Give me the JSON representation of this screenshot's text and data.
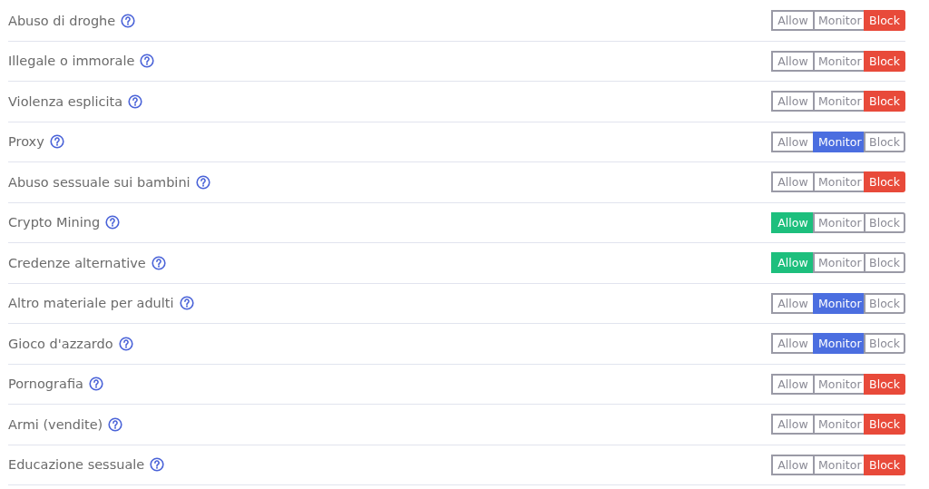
{
  "rows": [
    {
      "label": "Abuso di droghe",
      "options": [
        {
          "label": "Allow",
          "kind": "allow",
          "selected": false
        },
        {
          "label": "Monitor",
          "kind": "monitor",
          "selected": false
        },
        {
          "label": "Block",
          "kind": "block",
          "selected": true
        }
      ]
    },
    {
      "label": "Illegale o immorale",
      "options": [
        {
          "label": "Allow",
          "kind": "allow",
          "selected": false
        },
        {
          "label": "Monitor",
          "kind": "monitor",
          "selected": false
        },
        {
          "label": "Block",
          "kind": "block",
          "selected": true
        }
      ]
    },
    {
      "label": "Violenza esplicita",
      "options": [
        {
          "label": "Allow",
          "kind": "allow",
          "selected": false
        },
        {
          "label": "Monitor",
          "kind": "monitor",
          "selected": false
        },
        {
          "label": "Block",
          "kind": "block",
          "selected": true
        }
      ]
    },
    {
      "label": "Proxy",
      "options": [
        {
          "label": "Allow",
          "kind": "allow",
          "selected": false
        },
        {
          "label": "Monitor",
          "kind": "monitor",
          "selected": true
        },
        {
          "label": "Block",
          "kind": "block",
          "selected": false
        }
      ]
    },
    {
      "label": "Abuso sessuale sui bambini",
      "options": [
        {
          "label": "Allow",
          "kind": "allow",
          "selected": false
        },
        {
          "label": "Monitor",
          "kind": "monitor",
          "selected": false
        },
        {
          "label": "Block",
          "kind": "block",
          "selected": true
        }
      ]
    },
    {
      "label": "Crypto Mining",
      "options": [
        {
          "label": "Allow",
          "kind": "allow",
          "selected": true
        },
        {
          "label": "Monitor",
          "kind": "monitor",
          "selected": false
        },
        {
          "label": "Block",
          "kind": "block",
          "selected": false
        }
      ]
    },
    {
      "label": "Credenze alternative",
      "options": [
        {
          "label": "Allow",
          "kind": "allow",
          "selected": true
        },
        {
          "label": "Monitor",
          "kind": "monitor",
          "selected": false
        },
        {
          "label": "Block",
          "kind": "block",
          "selected": false
        }
      ]
    },
    {
      "label": "Altro materiale per adulti",
      "options": [
        {
          "label": "Allow",
          "kind": "allow",
          "selected": false
        },
        {
          "label": "Monitor",
          "kind": "monitor",
          "selected": true
        },
        {
          "label": "Block",
          "kind": "block",
          "selected": false
        }
      ]
    },
    {
      "label": "Gioco d'azzardo",
      "options": [
        {
          "label": "Allow",
          "kind": "allow",
          "selected": false
        },
        {
          "label": "Monitor",
          "kind": "monitor",
          "selected": true
        },
        {
          "label": "Block",
          "kind": "block",
          "selected": false
        }
      ]
    },
    {
      "label": "Pornografia",
      "options": [
        {
          "label": "Allow",
          "kind": "allow",
          "selected": false
        },
        {
          "label": "Monitor",
          "kind": "monitor",
          "selected": false
        },
        {
          "label": "Block",
          "kind": "block",
          "selected": true
        }
      ]
    },
    {
      "label": "Armi (vendite)",
      "options": [
        {
          "label": "Allow",
          "kind": "allow",
          "selected": false
        },
        {
          "label": "Monitor",
          "kind": "monitor",
          "selected": false
        },
        {
          "label": "Block",
          "kind": "block",
          "selected": true
        }
      ]
    },
    {
      "label": "Educazione sessuale",
      "options": [
        {
          "label": "Allow",
          "kind": "allow",
          "selected": false
        },
        {
          "label": "Monitor",
          "kind": "monitor",
          "selected": false
        },
        {
          "label": "Block",
          "kind": "block",
          "selected": true
        }
      ]
    }
  ]
}
